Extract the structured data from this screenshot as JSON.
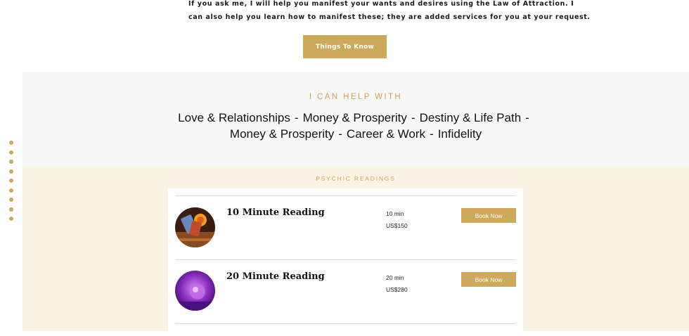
{
  "intro": {
    "line1": "If you ask me, I will help you manifest your wants and desires using the Law of Attraction. I",
    "line2": "can also help you learn how to manifest these; they are added services for you at your request."
  },
  "things_button_label": "Things To Know",
  "help": {
    "title": "I CAN HELP WITH",
    "row1": [
      "Love & Relationships",
      "Money & Prosperity",
      "Destiny & Life Path"
    ],
    "row2": [
      "Money & Prosperity",
      "Career & Work",
      "Infidelity"
    ],
    "separator": "-"
  },
  "readings": {
    "title": "PSYCHIC READINGS",
    "services": [
      {
        "name": "10 Minute Reading",
        "duration": "10 min",
        "price": "US$150",
        "button": "Book Now"
      },
      {
        "name": "20 Minute Reading",
        "duration": "20 min",
        "price": "US$280",
        "button": "Book Now"
      }
    ]
  },
  "side_nav": {
    "dot_count": 9
  },
  "colors": {
    "accent": "#cda95a",
    "help_bg": "#f8f8f8",
    "readings_bg": "#fbf3e3"
  }
}
